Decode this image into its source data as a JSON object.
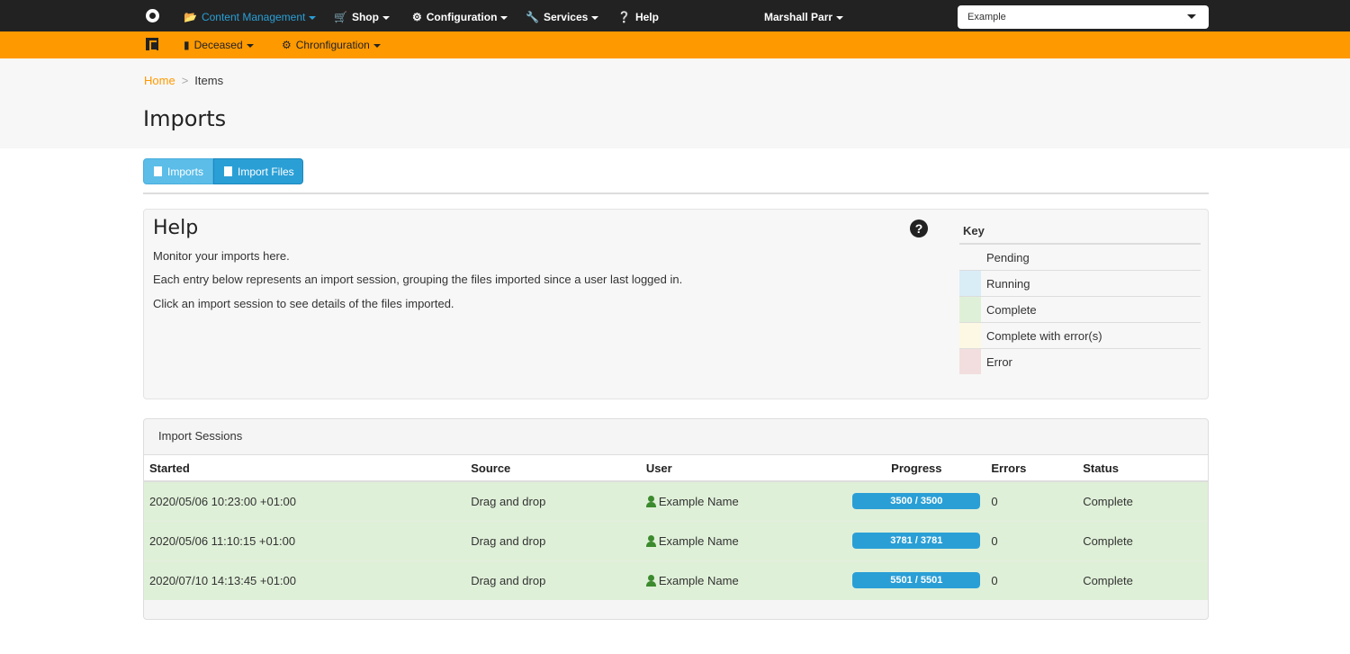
{
  "topnav": {
    "logo_icon": "swirl-logo-icon",
    "items": [
      {
        "label": "Content Management",
        "icon": "folder-open-icon",
        "active": true
      },
      {
        "label": "Shop",
        "icon": "cart-icon"
      },
      {
        "label": "Configuration",
        "icon": "gear-icon"
      },
      {
        "label": "Services",
        "icon": "wrench-icon"
      },
      {
        "label": "Help",
        "icon": "question-circle-icon"
      }
    ],
    "user": "Marshall Parr",
    "context_select": "Example"
  },
  "subnav": {
    "items": [
      {
        "label": "Deceased",
        "icon": "book-icon"
      },
      {
        "label": "Chronfiguration",
        "icon": "gear-icon"
      }
    ]
  },
  "breadcrumb": {
    "home": "Home",
    "separator": ">",
    "current": "Items"
  },
  "page_title": "Imports",
  "tabs": [
    {
      "label": "Imports",
      "icon": "import-icon"
    },
    {
      "label": "Import Files",
      "icon": "file-icon"
    }
  ],
  "help": {
    "title": "Help",
    "lines": [
      "Monitor your imports here.",
      "Each entry below represents an import session, grouping the files imported since a user last logged in.",
      "Click an import session to see details of the files imported."
    ],
    "key": {
      "title": "Key",
      "items": [
        {
          "label": "Pending",
          "color": "#f7f7f7"
        },
        {
          "label": "Running",
          "color": "#d9edf7"
        },
        {
          "label": "Complete",
          "color": "#dff0d8"
        },
        {
          "label": "Complete with error(s)",
          "color": "#fcf8e3"
        },
        {
          "label": "Error",
          "color": "#f2dede"
        }
      ]
    }
  },
  "sessions": {
    "title": "Import Sessions",
    "columns": [
      "Started",
      "Source",
      "User",
      "Progress",
      "Errors",
      "Status"
    ],
    "rows": [
      {
        "started": "2020/05/06 10:23:00 +01:00",
        "source": "Drag and drop",
        "user": "Example Name",
        "progress_text": "3500 / 3500",
        "progress": 1.0,
        "errors": "0",
        "status": "Complete"
      },
      {
        "started": "2020/05/06 11:10:15 +01:00",
        "source": "Drag and drop",
        "user": "Example Name",
        "progress_text": "3781 / 3781",
        "progress": 1.0,
        "errors": "0",
        "status": "Complete"
      },
      {
        "started": "2020/07/10 14:13:45 +01:00",
        "source": "Drag and drop",
        "user": "Example Name",
        "progress_text": "5501 / 5501",
        "progress": 1.0,
        "errors": "0",
        "status": "Complete"
      }
    ]
  },
  "colors": {
    "brand_orange": "#ff9900",
    "accent_blue": "#2a9fd6",
    "navbar_dark": "#222222"
  }
}
